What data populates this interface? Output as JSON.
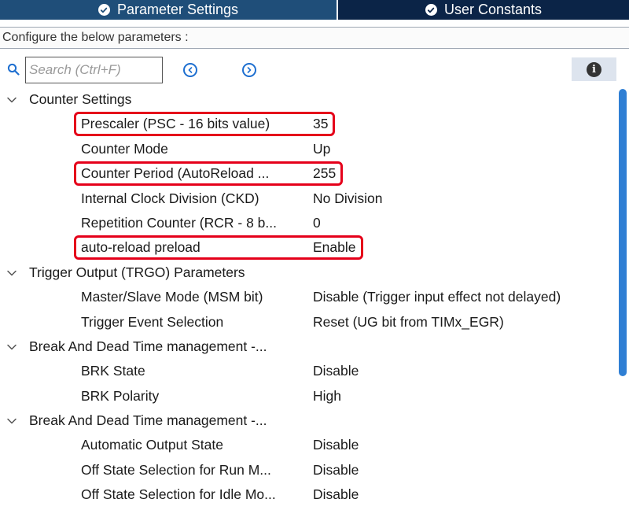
{
  "tabs": [
    {
      "label": "Parameter Settings",
      "active": true
    },
    {
      "label": "User Constants",
      "active": false
    }
  ],
  "subtitle": "Configure the below parameters :",
  "search": {
    "placeholder": "Search (Ctrl+F)",
    "value": ""
  },
  "icons": {
    "tab_check": "check-circle-icon",
    "search": "search-icon",
    "prev": "chevron-left-circle-icon",
    "next": "chevron-right-circle-icon",
    "info": "info-icon",
    "expand": "chevron-down-icon"
  },
  "info_glyph": "i",
  "colors": {
    "tab_active": "#1f4e79",
    "tab_inactive": "#0b2447",
    "highlight": "#e5001a",
    "accent": "#1e6fd0",
    "scrollbar": "#2f7fd4"
  },
  "groups": [
    {
      "label": "Counter Settings",
      "params": [
        {
          "name": "Prescaler (PSC - 16 bits value)",
          "value": "35",
          "highlighted": true
        },
        {
          "name": "Counter Mode",
          "value": "Up",
          "highlighted": false
        },
        {
          "name": "Counter Period (AutoReload ...",
          "value": "255",
          "highlighted": true
        },
        {
          "name": "Internal Clock Division (CKD)",
          "value": "No Division",
          "highlighted": false
        },
        {
          "name": "Repetition Counter (RCR - 8 b...",
          "value": "0",
          "highlighted": false
        },
        {
          "name": "auto-reload preload",
          "value": "Enable",
          "highlighted": true
        }
      ]
    },
    {
      "label": "Trigger Output (TRGO) Parameters",
      "params": [
        {
          "name": "Master/Slave Mode (MSM bit)",
          "value": "Disable (Trigger input effect not delayed)",
          "highlighted": false
        },
        {
          "name": "Trigger Event Selection",
          "value": "Reset (UG bit from TIMx_EGR)",
          "highlighted": false
        }
      ]
    },
    {
      "label": "Break And Dead Time management -...",
      "params": [
        {
          "name": "BRK State",
          "value": "Disable",
          "highlighted": false
        },
        {
          "name": "BRK Polarity",
          "value": "High",
          "highlighted": false
        }
      ]
    },
    {
      "label": "Break And Dead Time management -...",
      "params": [
        {
          "name": "Automatic Output State",
          "value": "Disable",
          "highlighted": false
        },
        {
          "name": "Off State Selection for Run M...",
          "value": "Disable",
          "highlighted": false
        },
        {
          "name": "Off State Selection for Idle Mo...",
          "value": "Disable",
          "highlighted": false
        }
      ]
    }
  ]
}
